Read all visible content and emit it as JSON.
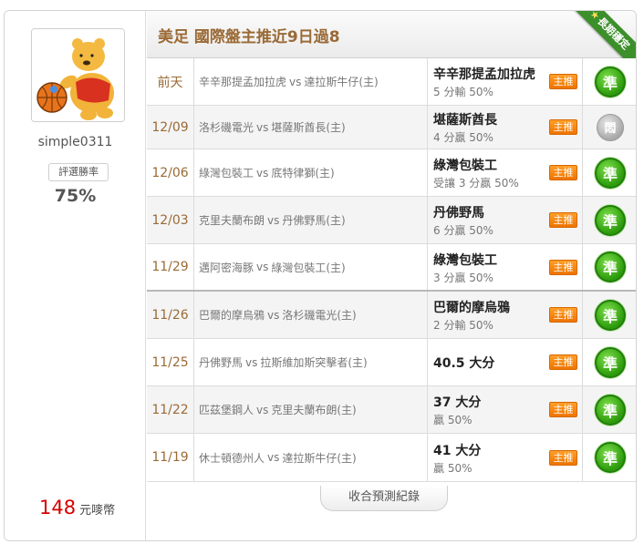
{
  "user": {
    "name": "simple0311",
    "rate_label": "評選勝率",
    "rate_value": "75%",
    "coins_value": "148",
    "coins_unit": "元嘜幣"
  },
  "header": {
    "title": "美足 國際盤主推近9日過8",
    "ribbon": "長期穩定"
  },
  "tag_label": "主推",
  "rows": [
    {
      "date": "前天",
      "home": "辛辛那提孟加拉虎",
      "vs": "vs",
      "away": "達拉斯牛仔(主)",
      "pick": "辛辛那提孟加拉虎",
      "odds": "5 分輸 50%",
      "result": "準",
      "result_type": "win"
    },
    {
      "date": "12/09",
      "home": "洛杉磯電光",
      "vs": "vs",
      "away": "堪薩斯酋長(主)",
      "pick": "堪薩斯酋長",
      "odds": "4 分贏 50%",
      "result": "悶",
      "result_type": "push"
    },
    {
      "date": "12/06",
      "home": "綠灣包裝工",
      "vs": "vs",
      "away": "底特律獅(主)",
      "pick": "綠灣包裝工",
      "odds": "受讓 3 分贏 50%",
      "result": "準",
      "result_type": "win"
    },
    {
      "date": "12/03",
      "home": "克里夫蘭布朗",
      "vs": "vs",
      "away": "丹佛野馬(主)",
      "pick": "丹佛野馬",
      "odds": "6 分贏 50%",
      "result": "準",
      "result_type": "win"
    },
    {
      "date": "11/29",
      "home": "邁阿密海豚",
      "vs": "vs",
      "away": "綠灣包裝工(主)",
      "pick": "綠灣包裝工",
      "odds": "3 分贏 50%",
      "result": "準",
      "result_type": "win"
    },
    {
      "date": "11/26",
      "home": "巴爾的摩烏鴉",
      "vs": "vs",
      "away": "洛杉磯電光(主)",
      "pick": "巴爾的摩烏鴉",
      "odds": "2 分輸 50%",
      "result": "準",
      "result_type": "win"
    },
    {
      "date": "11/25",
      "home": "丹佛野馬",
      "vs": "vs",
      "away": "拉斯維加斯突擊者(主)",
      "pick": "40.5 大分",
      "odds": "",
      "result": "準",
      "result_type": "win"
    },
    {
      "date": "11/22",
      "home": "匹茲堡鋼人",
      "vs": "vs",
      "away": "克里夫蘭布朗(主)",
      "pick": "37 大分",
      "odds": "贏 50%",
      "result": "準",
      "result_type": "win"
    },
    {
      "date": "11/19",
      "home": "休士頓德州人",
      "vs": "vs",
      "away": "達拉斯牛仔(主)",
      "pick": "41 大分",
      "odds": "贏 50%",
      "result": "準",
      "result_type": "win"
    }
  ],
  "collapse_label": "收合預測紀錄"
}
